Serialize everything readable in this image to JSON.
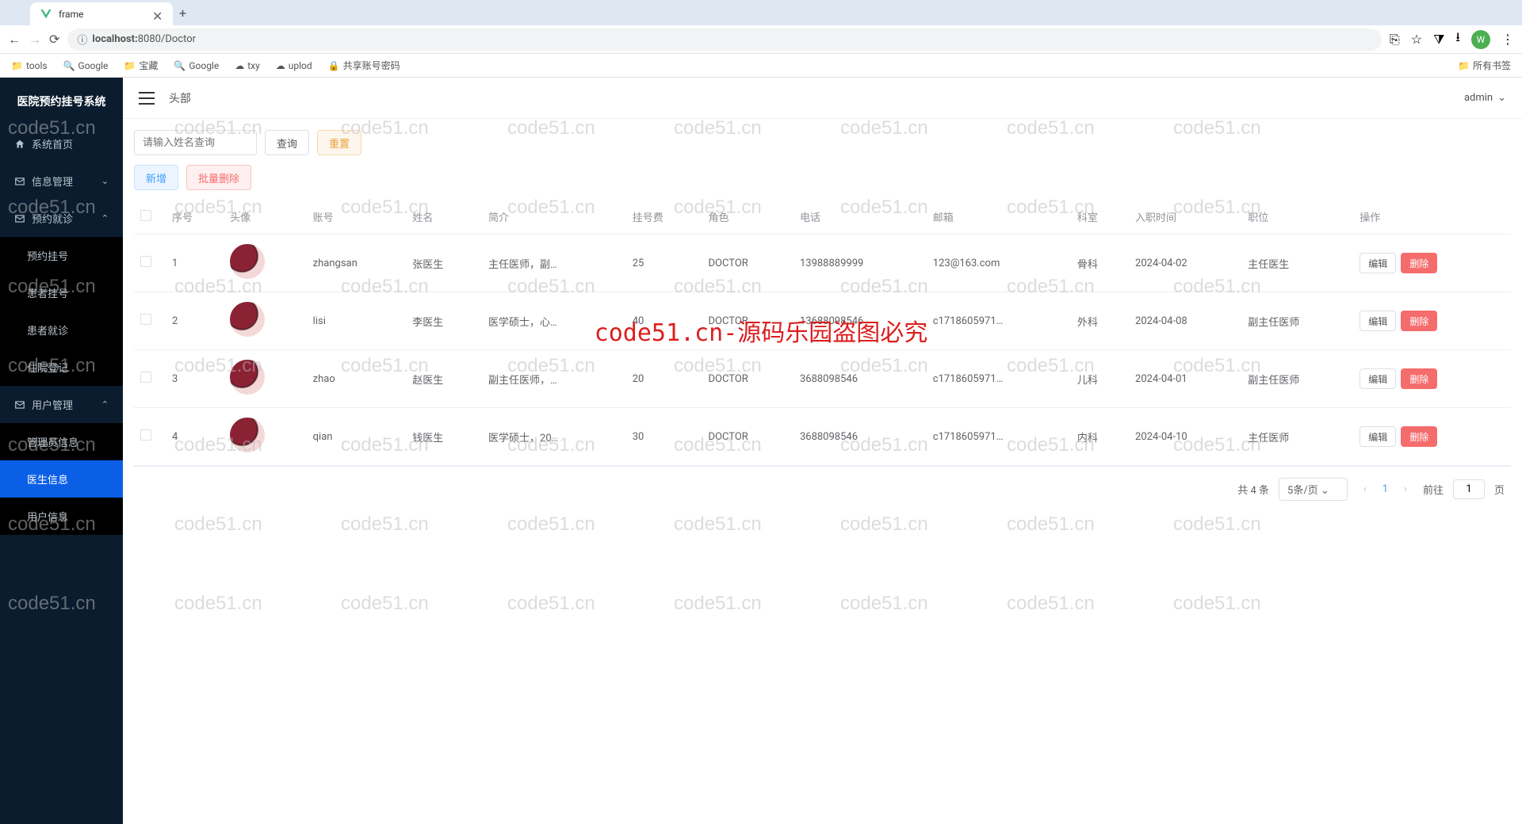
{
  "browser": {
    "tab_title": "frame",
    "new_tab": "+",
    "url_prefix": "localhost:",
    "url_rest": "8080/Doctor",
    "bookmarks": [
      "tools",
      "Google",
      "宝藏",
      "Google",
      "txy",
      "uplod",
      "共享账号密码"
    ],
    "all_bookmarks": "所有书签",
    "avatar_letter": "W"
  },
  "sidebar": {
    "title": "医院预约挂号系统",
    "items": [
      {
        "label": "系统首页",
        "icon": "home"
      },
      {
        "label": "信息管理",
        "icon": "mail",
        "chevron": "down"
      },
      {
        "label": "预约就诊",
        "icon": "mail",
        "chevron": "up",
        "children": [
          {
            "label": "预约挂号"
          },
          {
            "label": "患者挂号"
          },
          {
            "label": "患者就诊"
          },
          {
            "label": "住院登记"
          }
        ]
      },
      {
        "label": "用户管理",
        "icon": "mail",
        "chevron": "up",
        "children": [
          {
            "label": "管理员信息"
          },
          {
            "label": "医生信息",
            "active": true
          },
          {
            "label": "用户信息"
          }
        ]
      }
    ]
  },
  "header": {
    "title": "头部",
    "user": "admin"
  },
  "search": {
    "placeholder": "请输入姓名查询",
    "query_btn": "查询",
    "reset_btn": "重置"
  },
  "actions": {
    "add": "新增",
    "batch_delete": "批量删除"
  },
  "table": {
    "columns": [
      "序号",
      "头像",
      "账号",
      "姓名",
      "简介",
      "挂号费",
      "角色",
      "电话",
      "邮箱",
      "科室",
      "入职时间",
      "职位",
      "操作"
    ],
    "edit": "编辑",
    "delete": "删除",
    "rows": [
      {
        "seq": "1",
        "account": "zhangsan",
        "name": "张医生",
        "intro": "主任医师，副…",
        "fee": "25",
        "role": "DOCTOR",
        "phone": "13988889999",
        "email": "123@163.com",
        "dept": "骨科",
        "hired": "2024-04-02",
        "pos": "主任医生"
      },
      {
        "seq": "2",
        "account": "lisi",
        "name": "李医生",
        "intro": "医学硕士，心…",
        "fee": "40",
        "role": "DOCTOR",
        "phone": "13688098546",
        "email": "c1718605971…",
        "dept": "外科",
        "hired": "2024-04-08",
        "pos": "副主任医师"
      },
      {
        "seq": "3",
        "account": "zhao",
        "name": "赵医生",
        "intro": "副主任医师，…",
        "fee": "20",
        "role": "DOCTOR",
        "phone": "3688098546",
        "email": "c1718605971…",
        "dept": "儿科",
        "hired": "2024-04-01",
        "pos": "副主任医师"
      },
      {
        "seq": "4",
        "account": "qian",
        "name": "钱医生",
        "intro": "医学硕士，20…",
        "fee": "30",
        "role": "DOCTOR",
        "phone": "3688098546",
        "email": "c1718605971…",
        "dept": "内科",
        "hired": "2024-04-10",
        "pos": "主任医师"
      }
    ]
  },
  "pager": {
    "total": "共 4 条",
    "per_page": "5条/页",
    "current": "1",
    "goto_prefix": "前往",
    "goto_suffix": "页",
    "goto_value": "1"
  },
  "watermark": {
    "main": "code51.cn-源码乐园盗图必究",
    "bg": "code51.cn"
  }
}
